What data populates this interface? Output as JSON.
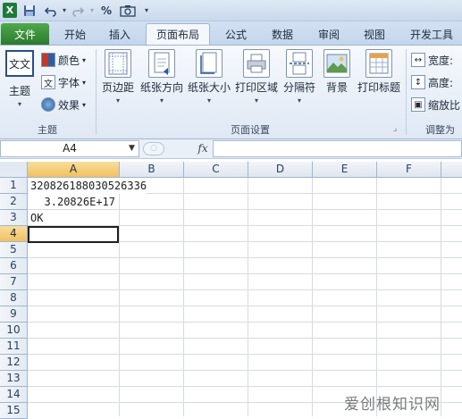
{
  "quick_access": {
    "app_icon": "X",
    "percent_icon": "%"
  },
  "tabs": [
    {
      "label": "文件"
    },
    {
      "label": "开始"
    },
    {
      "label": "插入"
    },
    {
      "label": "页面布局"
    },
    {
      "label": "公式"
    },
    {
      "label": "数据"
    },
    {
      "label": "审阅"
    },
    {
      "label": "视图"
    },
    {
      "label": "开发工具"
    }
  ],
  "ribbon": {
    "themes_group": {
      "label": "主题",
      "theme_button": "主题",
      "colors": "颜色",
      "fonts": "字体",
      "effects": "效果",
      "theme_icon_text": "文文"
    },
    "page_setup_group": {
      "label": "页面设置",
      "margins": "页边距",
      "orientation": "纸张方向",
      "size": "纸张大小",
      "print_area": "打印区域",
      "breaks": "分隔符",
      "background": "背景",
      "print_titles": "打印标题"
    },
    "scale_group": {
      "label": "调整为",
      "width": "宽度:",
      "height": "高度:",
      "scale": "缩放比"
    }
  },
  "formula_bar": {
    "name_box": "A4",
    "fx": "fx",
    "formula": ""
  },
  "sheet": {
    "columns": [
      "A",
      "B",
      "C",
      "D",
      "E",
      "F"
    ],
    "rows": [
      "1",
      "2",
      "3",
      "4",
      "5",
      "6",
      "7",
      "8",
      "9",
      "10",
      "11",
      "12",
      "13",
      "14",
      "15"
    ],
    "cells": {
      "A1": "320826188030526336",
      "A2": "3.20826E+17",
      "A3": "OK"
    },
    "selected_cell": "A4"
  },
  "watermark": "爱创根知识网",
  "colors": {
    "file_tab": "#2c7a2c",
    "selection_header": "#f1c15f"
  }
}
